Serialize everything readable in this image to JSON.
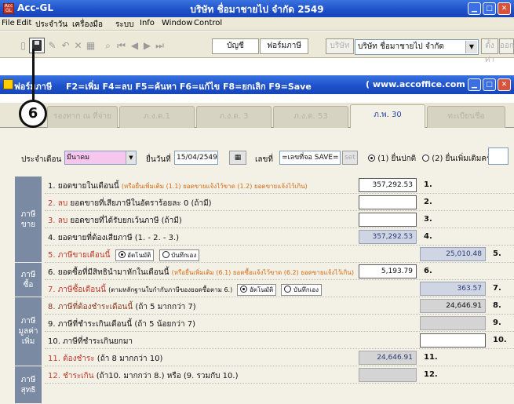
{
  "window": {
    "app_name": "Acc-GL",
    "title": "บริษัท ชื่อมาชายไป จำกัด 2549",
    "icon_text": "Acc GL"
  },
  "menu": [
    "File",
    "Edit",
    "ประจำวัน",
    "เครื่องมือ",
    "ระบบ",
    "Info",
    "Window",
    "Control"
  ],
  "toolbar": {
    "account_btn": "บัญชี",
    "form_btn": "ฟอร์มภาษี",
    "company_btn": "บริษัท",
    "company_select": "บริษัท ชื่อมาชายไป จำกัด",
    "setting_btn": "ตั้งค่า",
    "rest_btn": "ออก"
  },
  "form_bar": {
    "form_name": "ฟอร์มภาษี",
    "shortcuts": "F2=เพิ่ม  F4=ลบ  F5=ค้นหา  F6=แก้ไข  F8=ยกเลิก  F9=Save",
    "url": "( www.accoffice.com )"
  },
  "marker": {
    "number": "6"
  },
  "tabs": [
    {
      "label": "รองทาก ณ ที่จ่าย",
      "active": false
    },
    {
      "label": "ภ.ง.ด.1",
      "active": false
    },
    {
      "label": "ภ.ง.ด. 3",
      "active": false
    },
    {
      "label": "ภ.ง.ด. 53",
      "active": false
    },
    {
      "label": "ภ.พ. 30",
      "active": true
    },
    {
      "label": "ทะเบียนชื่อ",
      "active": false
    }
  ],
  "header": {
    "month_label": "ประจำเดือน",
    "month_value": "มีนาคม",
    "file_date_label": "ยื่นวันที่",
    "file_date_value": "15/04/2549",
    "number_label": "เลขที่",
    "number_value": "=เลขที่จอ SAVE=",
    "set_btn": "set",
    "radio1": "(1) ยื่นปกติ",
    "radio2": "(2) ยื่นเพิ่มเติมครั้งที่",
    "radio2_value": ""
  },
  "sections": [
    {
      "label": "ภาษี\nขาย"
    },
    {
      "label": "ภาษี\nซื้อ"
    },
    {
      "label": "ภาษี\nมูลค่า\nเพิ่ม"
    },
    {
      "label": "ภาษี\nสุทธิ"
    }
  ],
  "rows": [
    {
      "label": "1. ยอดขายในเดือนนี้",
      "note": "(หรือยื่นเพิ่มเติม (1.1) ยอดขายแจ้งไว้ขาด (1.2) ยอดขายแจ้งไว้เกิน)",
      "value": "357,292.53",
      "num": "1."
    },
    {
      "label_red": "2. ลบ",
      "label_rest": "ยอดขายที่เสียภาษีในอัตราร้อยละ 0 (ถ้ามี)",
      "value": "",
      "num": "2."
    },
    {
      "label_red": "3. ลบ",
      "label_rest": "ยอดขายที่ได้รับยกเว้นภาษี (ถ้ามี)",
      "value": "",
      "num": "3."
    },
    {
      "label": "4. ยอดขายที่ต้องเสียภาษี (1. - 2. - 3.)",
      "value": "357,292.53",
      "num": "4."
    },
    {
      "label_red": "5. ภาษีขายเดือนนี้",
      "opt1": "อัตโนมัติ",
      "opt2": "บันทึกเอง",
      "value": "25,010.48",
      "num": "5."
    },
    {
      "label": "6. ยอดซื้อที่มีสิทธินำมาหักในเดือนนี้",
      "note": "(หรือยื่นเพิ่มเติม (6.1) ยอดซื้อแจ้งไว้ขาด (6.2) ยอดขายแจ้งไว้เกิน)",
      "value": "5,193.79",
      "num": "6."
    },
    {
      "label_red": "7. ภาษีซื้อเดือนนี้",
      "label_rest": "(ตามหลักฐานใบกำกับภาษีของยอดซื้อตาม 6.)",
      "opt1": "อัตโนมัติ",
      "opt2": "บันทึกเอง",
      "value": "363.57",
      "num": "7."
    },
    {
      "label_red": "8. ภาษีที่ต้องชำระเดือนนี้",
      "label_rest": "(ถ้า 5 มากกว่า 7)",
      "value": "24,646.91",
      "num": "8."
    },
    {
      "label": "9. ภาษีที่ชำระเกินเดือนนี้ (ถ้า 5 น้อยกว่า 7)",
      "value": "",
      "num": "9."
    },
    {
      "label": "10. ภาษีที่ชำระเกินยกมา",
      "value": "",
      "num": "10."
    },
    {
      "label_red": "11. ต้องชำระ",
      "label_rest": "(ถ้า 8 มากกว่า 10)",
      "value": "24,646.91",
      "num": "11."
    },
    {
      "label_red": "12. ชำระเกิน",
      "label_rest": "(ถ้า10. มากกว่า 8.) หรือ (9. รวมกับ 10.)",
      "value": "",
      "num": "12."
    }
  ]
}
